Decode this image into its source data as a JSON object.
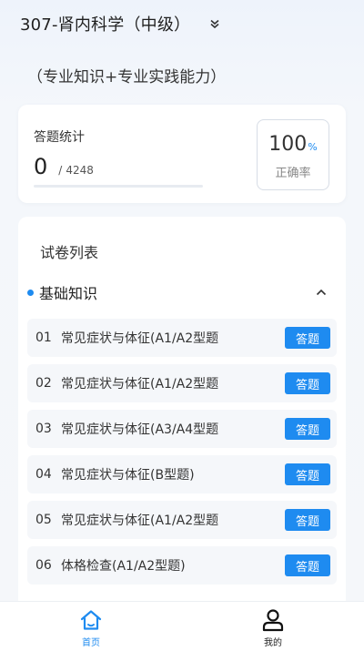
{
  "header": {
    "title": "307-肾内科学（中级）",
    "chevron_icon": "double-chevron-down-icon"
  },
  "subtitle": "（专业知识+专业实践能力）",
  "stats": {
    "label": "答题统计",
    "answered": "0",
    "slash": "/",
    "total": "4248",
    "progress_fraction": 0,
    "accuracy_value": "100",
    "accuracy_unit": "%",
    "accuracy_label": "正确率"
  },
  "paper_list": {
    "title": "试卷列表",
    "section": {
      "label": "基础知识",
      "toggle_icon": "chevron-up-icon"
    },
    "items": [
      {
        "num": "01",
        "name": "常见症状与体征(A1/A2型题",
        "button": "答题"
      },
      {
        "num": "02",
        "name": "常见症状与体征(A1/A2型题",
        "button": "答题"
      },
      {
        "num": "03",
        "name": "常见症状与体征(A3/A4型题",
        "button": "答题"
      },
      {
        "num": "04",
        "name": "常见症状与体征(B型题)",
        "button": "答题"
      },
      {
        "num": "05",
        "name": "常见症状与体征(A1/A2型题",
        "button": "答题"
      },
      {
        "num": "06",
        "name": "体格检查(A1/A2型题)",
        "button": "答题"
      }
    ]
  },
  "bottom_nav": {
    "home": {
      "label": "首页",
      "icon": "home-icon"
    },
    "mine": {
      "label": "我的",
      "icon": "user-icon"
    }
  },
  "colors": {
    "accent": "#1e8bf0"
  }
}
